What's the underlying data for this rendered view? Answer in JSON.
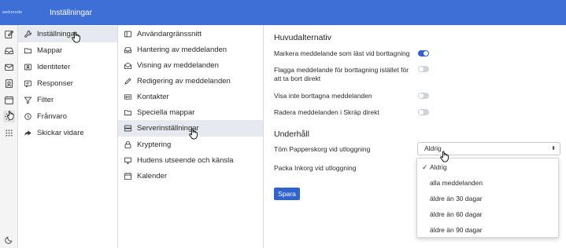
{
  "header": {
    "logo": "webmode",
    "title": "Inställningar"
  },
  "rail": {
    "icons": [
      "compose-icon",
      "inbox-icon",
      "mail-icon",
      "contacts-icon",
      "calendar-icon",
      "settings-icon",
      "apps-icon",
      "dark-mode-icon"
    ]
  },
  "settings_menu": {
    "items": [
      {
        "label": "Inställningar",
        "icon": "wrench-icon"
      },
      {
        "label": "Mappar",
        "icon": "folder-icon"
      },
      {
        "label": "Identiteter",
        "icon": "identity-icon"
      },
      {
        "label": "Responser",
        "icon": "response-icon"
      },
      {
        "label": "Filter",
        "icon": "filter-icon"
      },
      {
        "label": "Frånvaro",
        "icon": "clock-icon"
      },
      {
        "label": "Skickar vidare",
        "icon": "forward-icon"
      }
    ]
  },
  "preferences_menu": {
    "items": [
      {
        "label": "Användargränssnitt",
        "icon": "ui-icon"
      },
      {
        "label": "Hantering av meddelanden",
        "icon": "inbox-icon"
      },
      {
        "label": "Visning av meddelanden",
        "icon": "envelope-open-icon"
      },
      {
        "label": "Redigering av meddelanden",
        "icon": "pencil-icon"
      },
      {
        "label": "Kontakter",
        "icon": "card-icon"
      },
      {
        "label": "Speciella mappar",
        "icon": "folder-icon"
      },
      {
        "label": "Serverinställningar",
        "icon": "server-icon"
      },
      {
        "label": "Kryptering",
        "icon": "lock-icon"
      },
      {
        "label": "Hudens utseende och känsla",
        "icon": "monitor-icon"
      },
      {
        "label": "Kalender",
        "icon": "calendar-icon"
      }
    ]
  },
  "main": {
    "section1_title": "Huvudalternativ",
    "options": [
      {
        "label": "Markera meddelande som läst vid borttagning",
        "on": true
      },
      {
        "label": "Flagga meddelande för borttagning istället för att ta bort direkt",
        "on": false
      },
      {
        "label": "Visa inte borttagna meddelanden",
        "on": false
      },
      {
        "label": "Radera meddelanden i Skräp direkt",
        "on": false
      }
    ],
    "section2_title": "Underhåll",
    "empty_trash_label": "Töm Papperskorg vid utloggning",
    "empty_trash_value": "Aldrig",
    "compact_inbox_label": "Packa Inkorg vid utloggning",
    "save_button": "Spara",
    "dropdown_options": [
      "Aldrig",
      "alla meddelanden",
      "äldre än 30 dagar",
      "äldre än 60 dagar",
      "äldre än 90 dagar"
    ]
  },
  "colors": {
    "header": "#3d6fd6",
    "accent": "#2f63cf",
    "selected_row": "#e6e9ef"
  }
}
